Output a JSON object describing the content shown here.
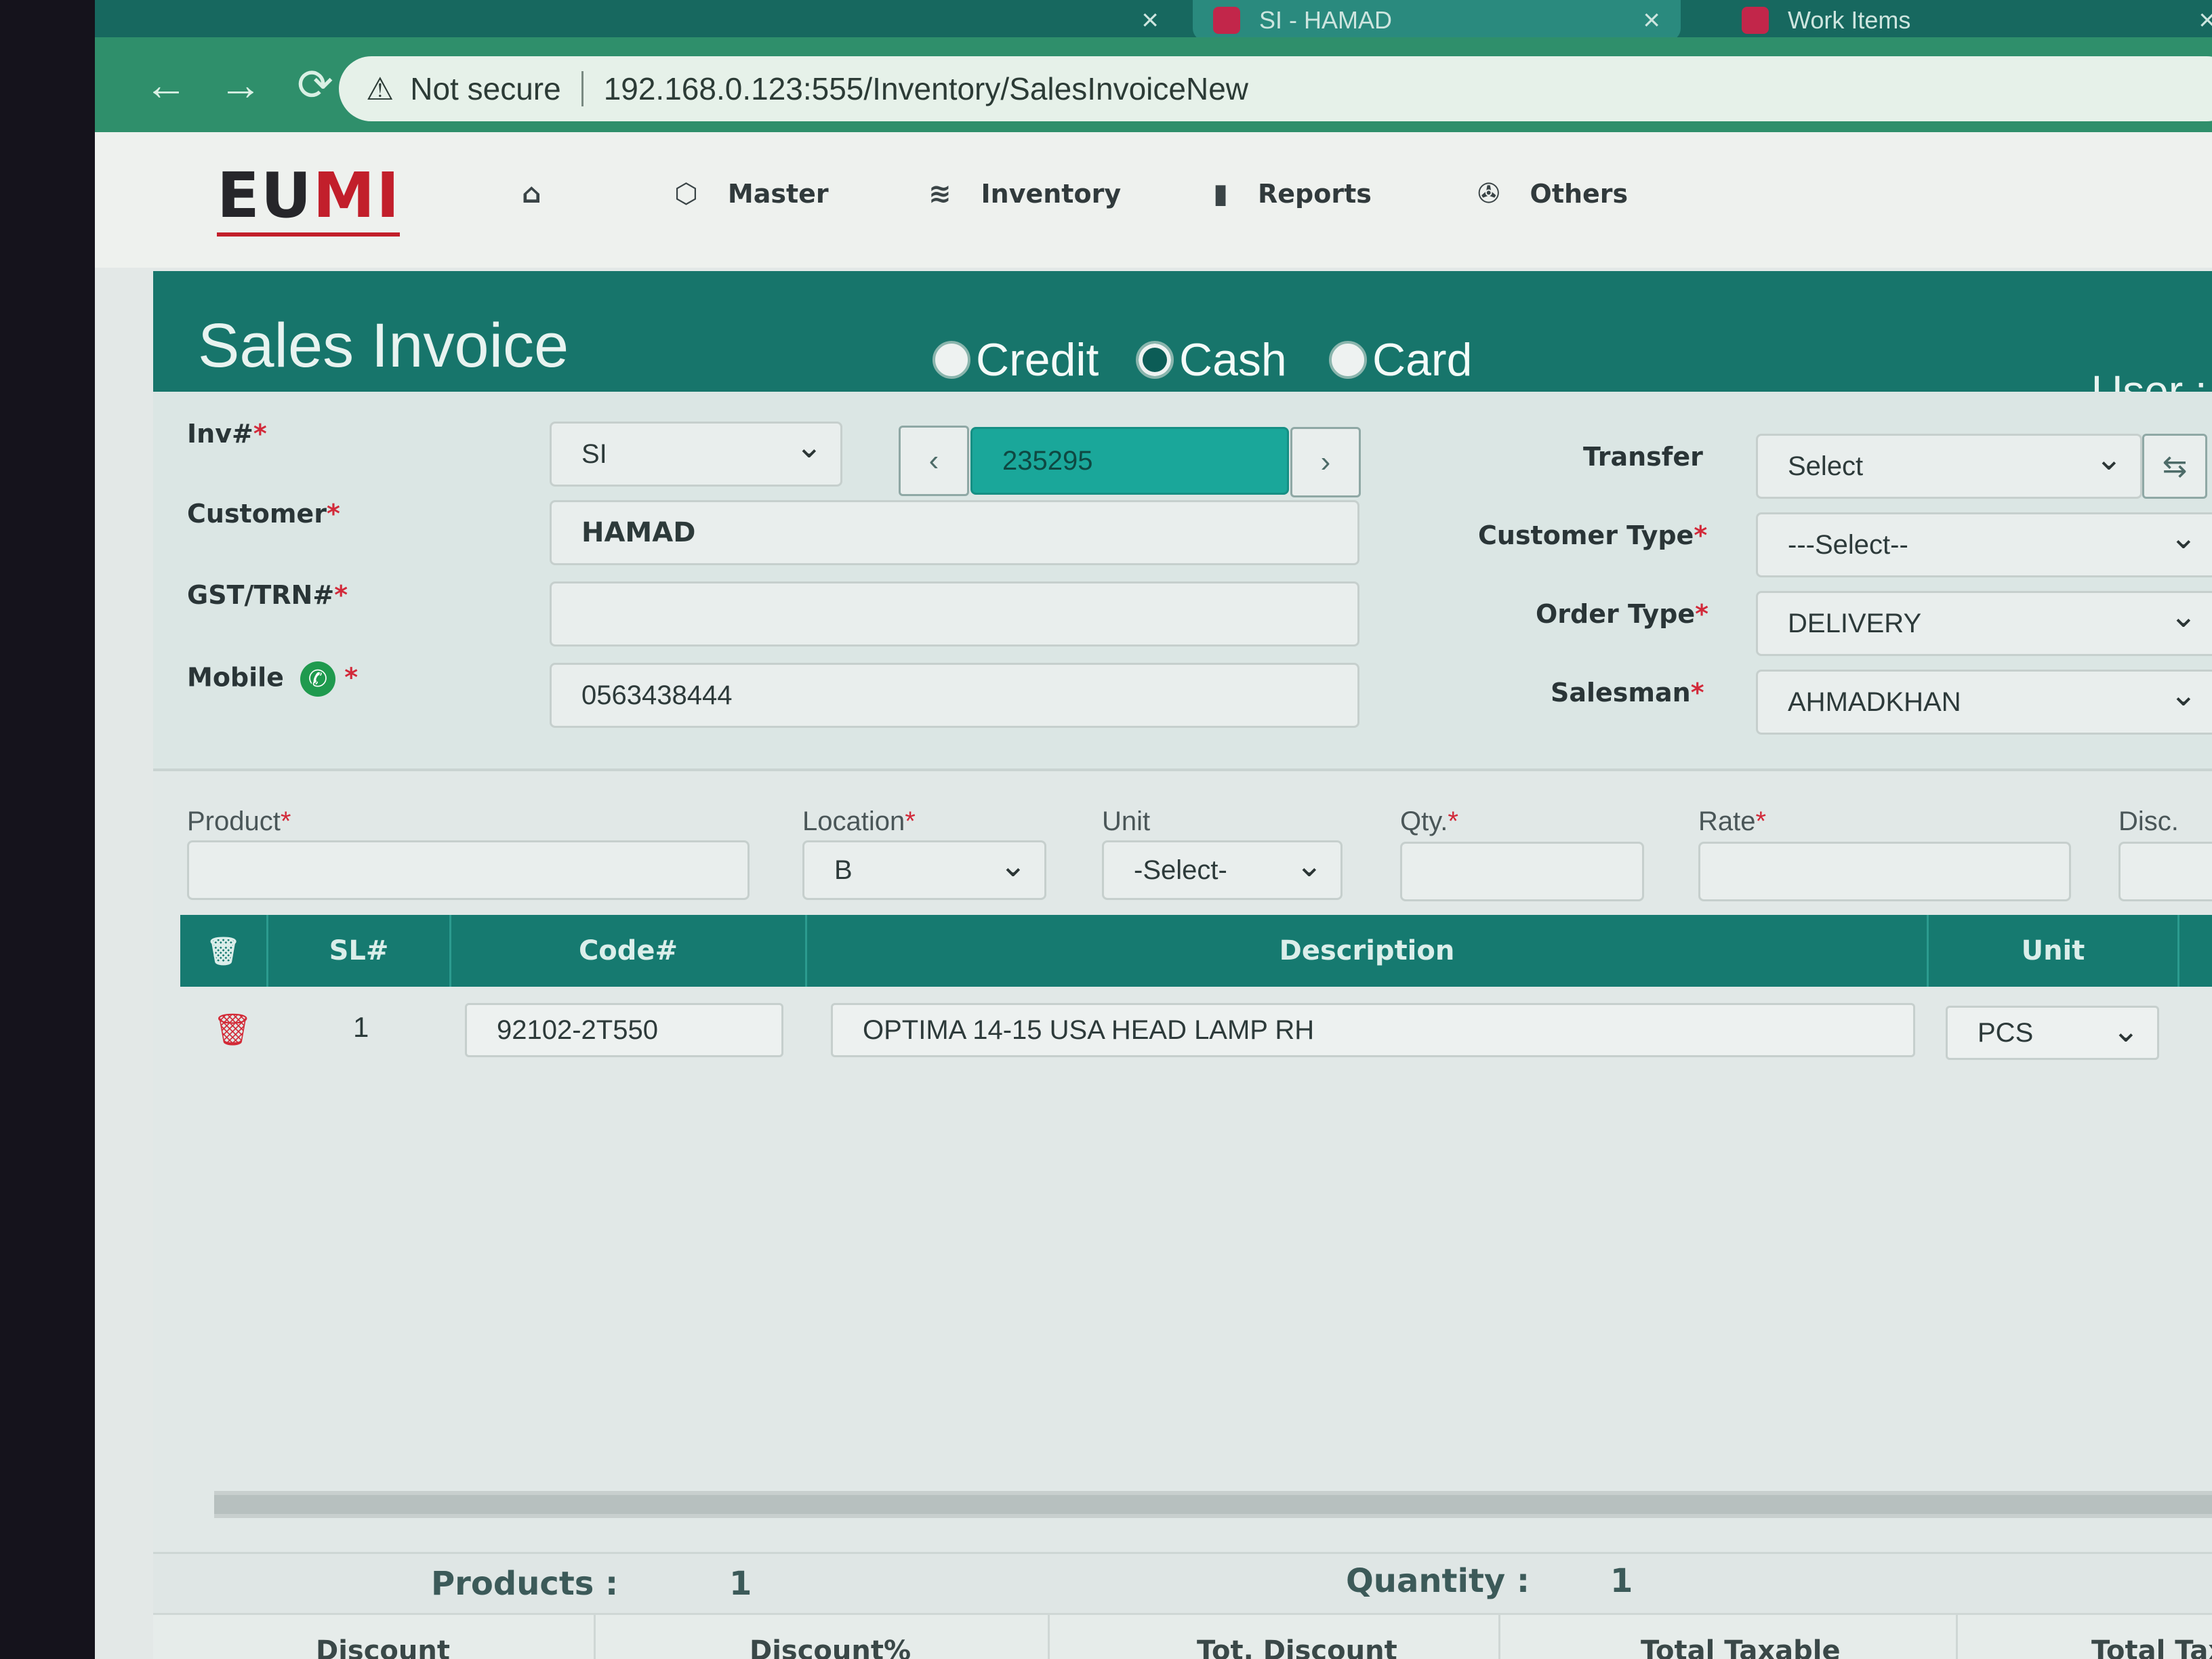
{
  "browser": {
    "tabs": [
      {
        "title": "",
        "active": false
      },
      {
        "title": "SI - HAMAD",
        "active": true
      },
      {
        "title": "Work Items",
        "active": false
      }
    ],
    "security_text": "Not secure",
    "url": "192.168.0.123:555/Inventory/SalesInvoiceNew"
  },
  "app": {
    "logo_main": "EU",
    "logo_accent": "MI",
    "menu": [
      {
        "label": "",
        "icon": "home-icon"
      },
      {
        "label": "Master",
        "icon": "cube-icon"
      },
      {
        "label": "Inventory",
        "icon": "layers-icon"
      },
      {
        "label": "Reports",
        "icon": "bar-chart-icon"
      },
      {
        "label": "Others",
        "icon": "aperture-icon"
      }
    ]
  },
  "invoice": {
    "title": "Sales Invoice",
    "payment_types": [
      {
        "label": "Credit",
        "checked": false
      },
      {
        "label": "Cash",
        "checked": true
      },
      {
        "label": "Card",
        "checked": false
      }
    ],
    "user_label": "User : @Ah",
    "labels": {
      "inv": "Inv#",
      "customer": "Customer",
      "gst": "GST/TRN#",
      "mobile": "Mobile",
      "transfer": "Transfer",
      "customer_type": "Customer Type",
      "order_type": "Order Type",
      "salesman": "Salesman"
    },
    "inv_prefix": "SI",
    "inv_number": "235295",
    "customer": "HAMAD",
    "gst": "",
    "mobile": "0563438444",
    "transfer": "Select",
    "customer_type": "---Select--",
    "order_type": "DELIVERY",
    "salesman": "AHMADKHAN",
    "prev_symbol": "‹",
    "next_symbol": "›"
  },
  "entry": {
    "labels": {
      "product": "Product",
      "location": "Location",
      "unit": "Unit",
      "qty": "Qty.",
      "rate": "Rate",
      "disc": "Disc."
    },
    "product": "",
    "location": "B",
    "unit": "-Select-",
    "qty": "",
    "rate": ""
  },
  "grid": {
    "headers": [
      "SL#",
      "Code#",
      "Description",
      "Unit"
    ],
    "rows": [
      {
        "sl": "1",
        "code": "92102-2T550",
        "description": "OPTIMA 14-15 USA HEAD LAMP RH",
        "unit": "PCS"
      }
    ]
  },
  "summary": {
    "products_label": "Products :",
    "products_value": "1",
    "quantity_label": "Quantity :",
    "quantity_value": "1"
  },
  "totals": [
    "Discount",
    "Discount%",
    "Tot. Discount",
    "Total Taxable",
    "Total Tax"
  ],
  "colors": {
    "primary_teal": "#17756b",
    "active_input": "#1aa79a",
    "required_red": "#d22a3a",
    "logo_red": "#c21f2b"
  }
}
